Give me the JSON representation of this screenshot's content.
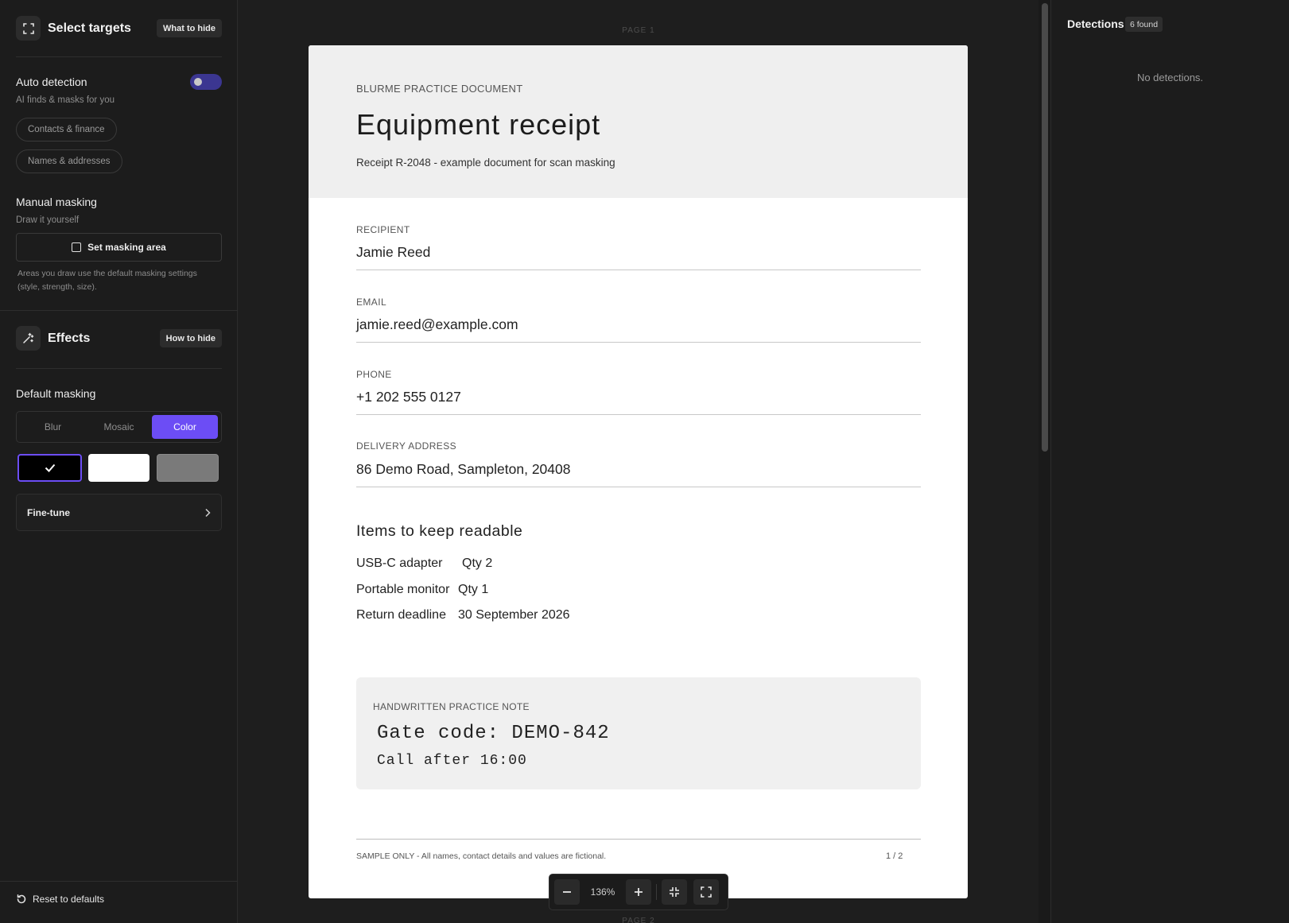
{
  "sidebar": {
    "select_targets": {
      "title": "Select targets",
      "button": "What to hide"
    },
    "auto_detection": {
      "title": "Auto detection",
      "subtitle": "AI finds & masks for you",
      "enabled": true,
      "chips": [
        "Contacts & finance",
        "Names & addresses"
      ]
    },
    "manual_masking": {
      "title": "Manual masking",
      "subtitle": "Draw it yourself",
      "button": "Set masking area",
      "note": "Areas you draw use the default masking settings (style, strength, size)."
    },
    "effects": {
      "title": "Effects",
      "button": "How to hide"
    },
    "default_masking": {
      "title": "Default masking",
      "options": [
        "Blur",
        "Mosaic",
        "Color"
      ],
      "selected": "Color",
      "swatches": [
        {
          "color": "#000000",
          "selected": true
        },
        {
          "color": "#ffffff",
          "selected": false
        },
        {
          "color": "#7a7a7a",
          "selected": false
        }
      ]
    },
    "fine_tune": "Fine-tune",
    "reset": "Reset to defaults"
  },
  "viewer": {
    "page_label": "PAGE 1",
    "next_page_label": "PAGE 2",
    "document": {
      "kicker": "BLURME PRACTICE DOCUMENT",
      "title": "Equipment receipt",
      "subtitle": "Receipt R-2048 - example document for scan masking",
      "fields": [
        {
          "label": "RECIPIENT",
          "value": "Jamie Reed"
        },
        {
          "label": "EMAIL",
          "value": "jamie.reed@example.com"
        },
        {
          "label": "PHONE",
          "value": "+1 202 555 0127"
        },
        {
          "label": "DELIVERY ADDRESS",
          "value": "86 Demo Road, Sampleton, 20408"
        }
      ],
      "items_title": "Items to keep readable",
      "items": [
        {
          "name": "USB-C adapter",
          "value": "Qty 2"
        },
        {
          "name": "Portable monitor",
          "value": "Qty 1"
        },
        {
          "name": "Return deadline",
          "value": "30 September 2026"
        }
      ],
      "note": {
        "kicker": "HANDWRITTEN PRACTICE NOTE",
        "line1": "Gate code: DEMO-842",
        "line2": "Call after 16:00"
      },
      "footer_left": "SAMPLE ONLY - All names, contact details and values are fictional.",
      "footer_right": "1 / 2"
    },
    "zoom": "136%"
  },
  "detections": {
    "title": "Detections",
    "badge": "6 found",
    "empty": "No detections."
  }
}
